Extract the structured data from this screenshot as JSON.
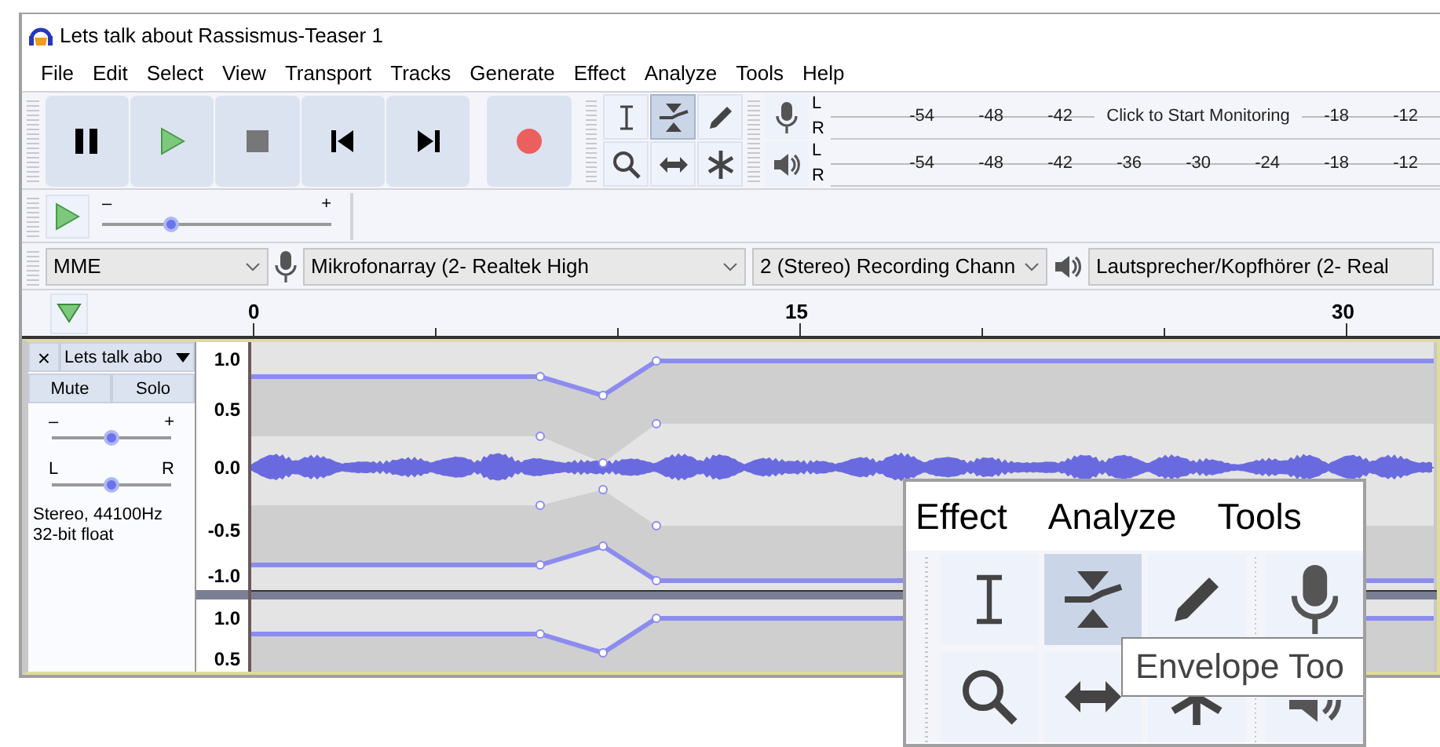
{
  "window": {
    "title": "Lets talk about Rassismus-Teaser 1"
  },
  "menu": [
    "File",
    "Edit",
    "Select",
    "View",
    "Transport",
    "Tracks",
    "Generate",
    "Effect",
    "Analyze",
    "Tools",
    "Help"
  ],
  "transport": [
    {
      "kind": "pause"
    },
    {
      "kind": "play"
    },
    {
      "kind": "stop"
    },
    {
      "kind": "start"
    },
    {
      "kind": "end"
    },
    {
      "kind": "record"
    }
  ],
  "tools": [
    {
      "kind": "select",
      "selected": false
    },
    {
      "kind": "envelope",
      "selected": true
    },
    {
      "kind": "draw",
      "selected": false
    },
    {
      "kind": "zoom",
      "selected": false
    },
    {
      "kind": "shift",
      "selected": false
    },
    {
      "kind": "multi",
      "selected": false
    }
  ],
  "meters": [
    {
      "kind": "record",
      "left": "L",
      "right": "R",
      "labels": [
        {
          "kind": "tick",
          "text": "-54"
        },
        {
          "kind": "tick",
          "text": "-48"
        },
        {
          "kind": "tick",
          "text": "-42"
        },
        {
          "kind": "prompt",
          "text": "Click to Start Monitoring"
        },
        {
          "kind": "tick",
          "text": "-18"
        },
        {
          "kind": "tick",
          "text": "-12"
        }
      ]
    },
    {
      "kind": "play",
      "left": "L",
      "right": "R",
      "labels": [
        {
          "kind": "tick",
          "text": "-54"
        },
        {
          "kind": "tick",
          "text": "-48"
        },
        {
          "kind": "tick",
          "text": "-42"
        },
        {
          "kind": "tick",
          "text": "-36"
        },
        {
          "kind": "tick",
          "text": "-30"
        },
        {
          "kind": "tick",
          "text": "-24"
        },
        {
          "kind": "tick",
          "text": "-18"
        },
        {
          "kind": "tick",
          "text": "-12"
        }
      ]
    }
  ],
  "play_at_speed": {
    "minus": "–",
    "plus": "+",
    "level": 0.3
  },
  "devices": {
    "host": "MME",
    "input": "Mikrofonarray (2- Realtek High",
    "channels": "2 (Stereo) Recording Chann",
    "output": "Lautsprecher/Kopfhörer (2- Real"
  },
  "timeline": {
    "labels": [
      "0",
      "15",
      "30"
    ]
  },
  "track": {
    "close": "×",
    "name": "Lets talk abo",
    "mute": "Mute",
    "solo": "Solo",
    "gain": {
      "minus": "–",
      "plus": "+",
      "level": 0.5
    },
    "pan": {
      "left": "L",
      "right": "R",
      "level": 0.5
    },
    "info": "Stereo, 44100Hz\n32-bit float",
    "ruler": [
      "1.0",
      "0.5",
      "0.0",
      "-0.5",
      "-1.0"
    ],
    "ruler_2": [
      "1.0",
      "0.5"
    ]
  },
  "inset": {
    "menu": [
      "Effect",
      "Analyze",
      "Tools"
    ],
    "tooltip": "Envelope Too"
  }
}
